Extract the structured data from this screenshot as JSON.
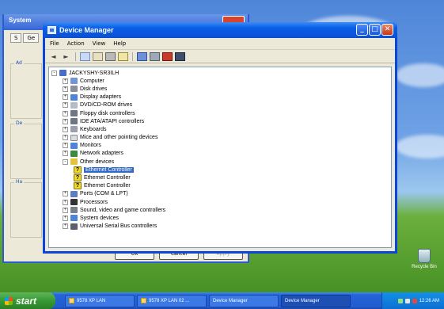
{
  "background_window": {
    "title": "System",
    "tabs": [
      "S",
      "Ge"
    ],
    "groups": [
      "Ad",
      "De",
      "Ha"
    ],
    "buttons": [
      "OK",
      "Cancel",
      "Apply"
    ]
  },
  "device_manager": {
    "title": "Device Manager",
    "menu": [
      "File",
      "Action",
      "View",
      "Help"
    ],
    "tree": [
      {
        "label": "JACKYSHY-SR3ILH",
        "level": 0,
        "expand": "-",
        "icon": "computer-root-icon"
      },
      {
        "label": "Computer",
        "level": 1,
        "expand": "+",
        "icon": "computer-icon"
      },
      {
        "label": "Disk drives",
        "level": 1,
        "expand": "+",
        "icon": "disk-drive-icon"
      },
      {
        "label": "Display adapters",
        "level": 1,
        "expand": "+",
        "icon": "display-adapter-icon"
      },
      {
        "label": "DVD/CD-ROM drives",
        "level": 1,
        "expand": "+",
        "icon": "dvd-drive-icon"
      },
      {
        "label": "Floppy disk controllers",
        "level": 1,
        "expand": "+",
        "icon": "floppy-controller-icon"
      },
      {
        "label": "IDE ATA/ATAPI controllers",
        "level": 1,
        "expand": "+",
        "icon": "ide-controller-icon"
      },
      {
        "label": "Keyboards",
        "level": 1,
        "expand": "+",
        "icon": "keyboard-icon"
      },
      {
        "label": "Mice and other pointing devices",
        "level": 1,
        "expand": "+",
        "icon": "mouse-icon"
      },
      {
        "label": "Monitors",
        "level": 1,
        "expand": "+",
        "icon": "monitor-icon"
      },
      {
        "label": "Network adapters",
        "level": 1,
        "expand": "+",
        "icon": "network-adapter-icon"
      },
      {
        "label": "Other devices",
        "level": 1,
        "expand": "-",
        "icon": "other-devices-icon"
      },
      {
        "label": "Ethernet Controller",
        "level": 2,
        "expand": "",
        "icon": "warning-device-icon",
        "selected": true
      },
      {
        "label": "Ethernet Controller",
        "level": 2,
        "expand": "",
        "icon": "warning-device-icon"
      },
      {
        "label": "Ethernet Controller",
        "level": 2,
        "expand": "",
        "icon": "warning-device-icon"
      },
      {
        "label": "Ports (COM & LPT)",
        "level": 1,
        "expand": "+",
        "icon": "port-icon"
      },
      {
        "label": "Processors",
        "level": 1,
        "expand": "+",
        "icon": "processor-icon"
      },
      {
        "label": "Sound, video and game controllers",
        "level": 1,
        "expand": "+",
        "icon": "sound-icon"
      },
      {
        "label": "System devices",
        "level": 1,
        "expand": "+",
        "icon": "system-device-icon"
      },
      {
        "label": "Universal Serial Bus controllers",
        "level": 1,
        "expand": "+",
        "icon": "usb-icon"
      }
    ]
  },
  "desktop": {
    "recycle_bin_label": "Recycle Bin"
  },
  "taskbar": {
    "start_label": "start",
    "tasks": [
      {
        "label": "9578 XP LAN",
        "active": false
      },
      {
        "label": "9578 XP LAN 02 ...",
        "active": false
      },
      {
        "label": "Device Manager",
        "active": false
      },
      {
        "label": "Device Manager",
        "active": true
      }
    ],
    "clock": "12:26 AM"
  },
  "colors": {
    "titlebar": "#0b4fd2",
    "selection": "#316ac5",
    "taskbar": "#225dd1",
    "start_button": "#379a33"
  }
}
